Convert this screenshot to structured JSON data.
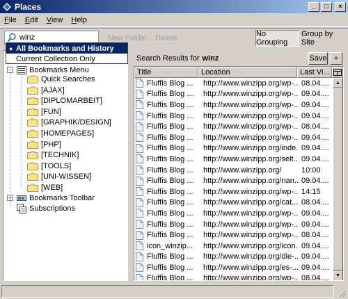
{
  "window": {
    "title": "Places",
    "controls": {
      "minimize": "_",
      "maximize": "□",
      "close": "×"
    }
  },
  "menu": [
    {
      "label": "File",
      "accel": "F",
      "rest": "ile"
    },
    {
      "label": "Edit",
      "accel": "E",
      "rest": "dit"
    },
    {
      "label": "View",
      "accel": "V",
      "rest": "iew"
    },
    {
      "label": "Help",
      "accel": "H",
      "rest": "elp"
    }
  ],
  "toolbar": {
    "search_value": "winz",
    "new_folder_label": "New Folder...",
    "delete_label": "Delete",
    "no_grouping_label": "No Grouping",
    "group_by_site_label": "Group by Site"
  },
  "search_scope_menu": {
    "items": [
      {
        "label": "All Bookmarks and History",
        "selected": true
      },
      {
        "label": "Current Collection Only",
        "selected": false
      }
    ]
  },
  "tree": {
    "root_label": "Bookmarks Menu",
    "folders": [
      "Quick Searches",
      "[AJAX]",
      "[DIPLOMARBEIT]",
      "[FUN]",
      "[GRAPHIK/DESIGN]",
      "[HOMEPAGES]",
      "[PHP]",
      "[TECHNIK]",
      "[TOOLS]",
      "[UNI-WISSEN]",
      "[WEB]"
    ],
    "toolbar_label": "Bookmarks Toolbar",
    "subscriptions_label": "Subscriptions"
  },
  "results": {
    "prefix": "Search Results for",
    "query": "winz",
    "save_label": "Save",
    "add_label": "+",
    "columns": {
      "title": "Title",
      "location": "Location",
      "last_visited": "Last Vi..."
    },
    "rows": [
      {
        "title": "Fluffis Blog ...",
        "location": "http://www.winzipp.org/wp-...",
        "date": "08.04...."
      },
      {
        "title": "Fluffis Blog ...",
        "location": "http://www.winzipp.org/wp-...",
        "date": "09.04...."
      },
      {
        "title": "Fluffis Blog ...",
        "location": "http://www.winzipp.org/wp-...",
        "date": "09.04...."
      },
      {
        "title": "Fluffis Blog ...",
        "location": "http://www.winzipp.org/wp-...",
        "date": "09.04...."
      },
      {
        "title": "Fluffis Blog ...",
        "location": "http://www.winzipp.org/wp-...",
        "date": "08.04...."
      },
      {
        "title": "Fluffis Blog ...",
        "location": "http://www.winzipp.org/wp-...",
        "date": "09.04...."
      },
      {
        "title": "Fluffis Blog ...",
        "location": "http://www.winzipp.org/inde...",
        "date": "09.04...."
      },
      {
        "title": "Fluffis Blog ...",
        "location": "http://www.winzipp.org/selt...",
        "date": "09.04...."
      },
      {
        "title": "Fluffis Blog ...",
        "location": "http://www.winzipp.org/",
        "date": "10:00"
      },
      {
        "title": "Fluffis Blog ...",
        "location": "http://www.winzipp.org/nan...",
        "date": "09.04...."
      },
      {
        "title": "Fluffis Blog ...",
        "location": "http://www.winzipp.org/wp-...",
        "date": "14:15"
      },
      {
        "title": "Fluffis Blog ...",
        "location": "http://www.winzipp.org/cat...",
        "date": "08.04...."
      },
      {
        "title": "Fluffis Blog ...",
        "location": "http://www.winzipp.org/wp-...",
        "date": "09.04...."
      },
      {
        "title": "Fluffis Blog ...",
        "location": "http://www.winzipp.org/wp-...",
        "date": "09.04...."
      },
      {
        "title": "Fluffis Blog ...",
        "location": "http://www.winzipp.org/wp-...",
        "date": "08.04...."
      },
      {
        "title": "icon_winzip...",
        "location": "http://www.winzipp.org/icon...",
        "date": "09.04...."
      },
      {
        "title": "Fluffis Blog ...",
        "location": "http://www.winzipp.org/die-...",
        "date": "09.04...."
      },
      {
        "title": "Fluffis Blog ...",
        "location": "http://www.winzipp.org/es-...",
        "date": "09.04...."
      },
      {
        "title": "Fluffis Blog ...",
        "location": "http://www.winzipp.org/wp-...",
        "date": "08.04...."
      }
    ]
  },
  "colors": {
    "title_gradient_start": "#0a246a",
    "title_gradient_end": "#a6caf0",
    "selection": "#0a246a",
    "face": "#d4d0c8"
  }
}
